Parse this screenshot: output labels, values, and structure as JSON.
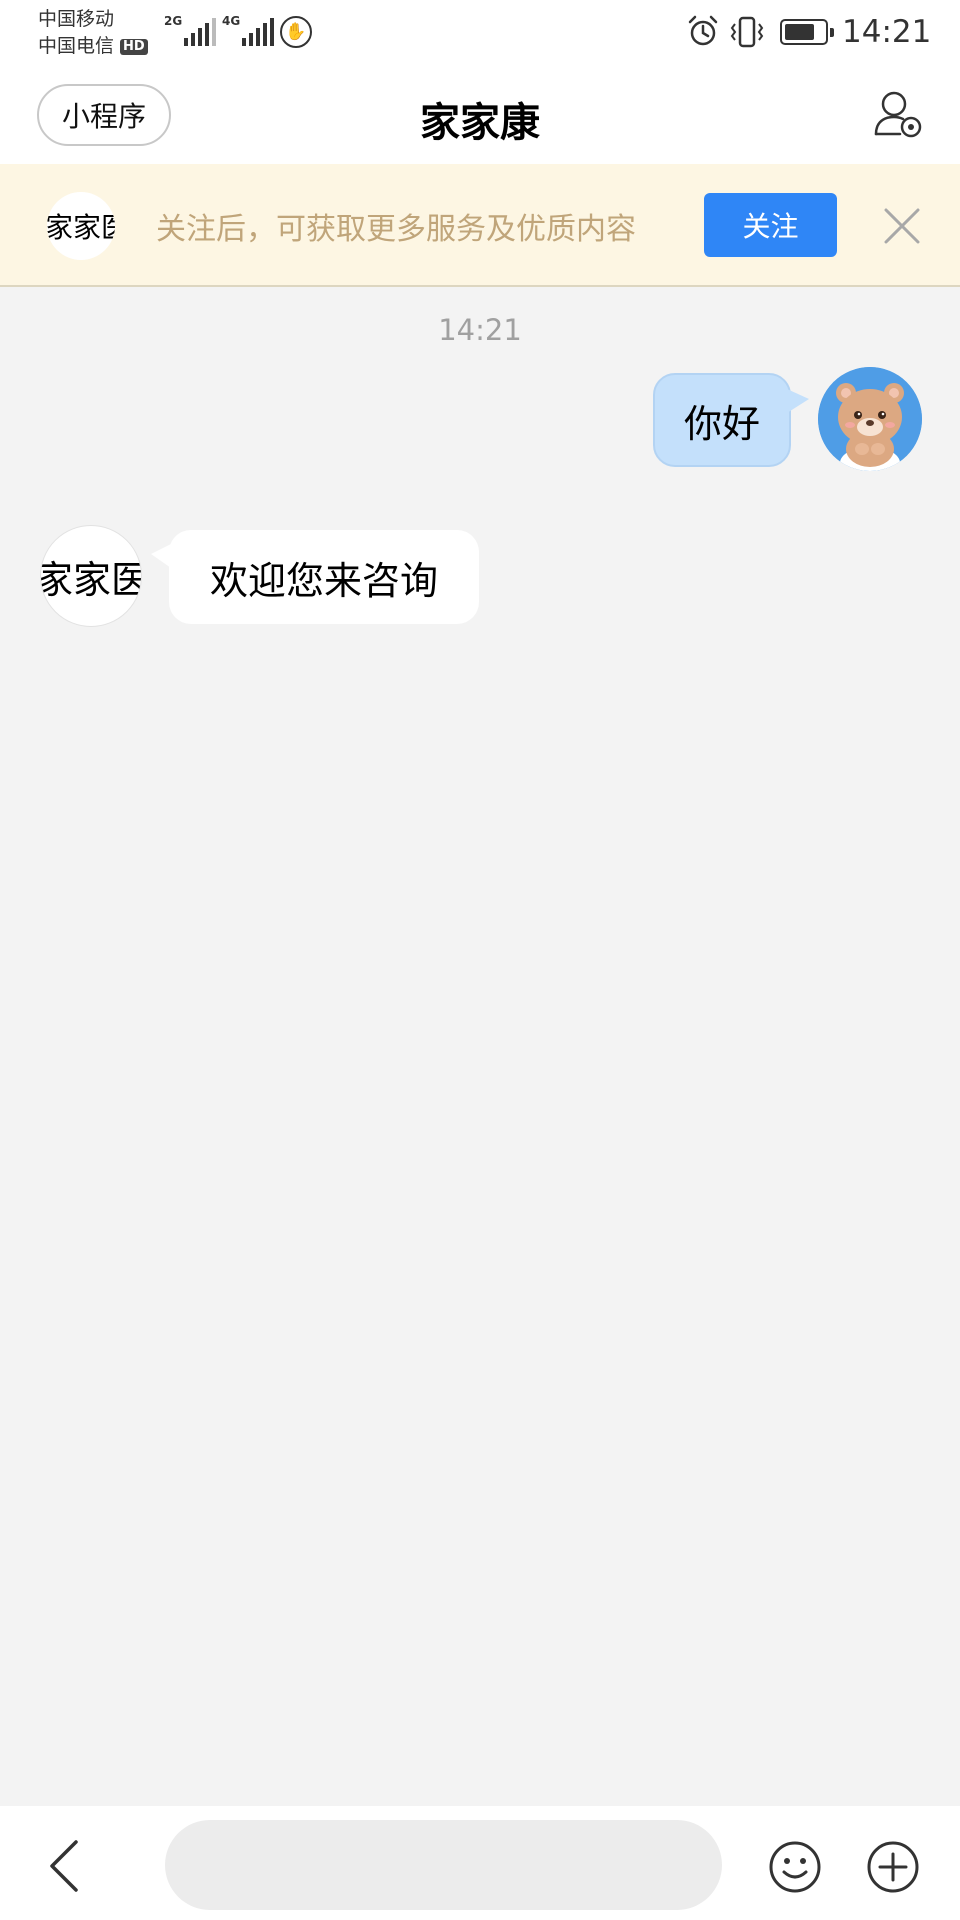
{
  "status_bar": {
    "carriers": [
      "中国移动",
      "中国电信"
    ],
    "hd_badge": "HD",
    "network_a": "2G",
    "network_b": "4G",
    "signal_a_level": 4,
    "signal_b_level": 5,
    "battery_level": 0.75,
    "time": "14:21",
    "icons": [
      "signal-icon",
      "hand-icon",
      "alarm-icon",
      "vibrate-icon",
      "battery-icon"
    ]
  },
  "header": {
    "mini_program_label": "小程序",
    "title": "家家康",
    "profile_icon": "profile-settings-icon"
  },
  "follow_banner": {
    "avatar_text": "家家医",
    "text": "关注后，可获取更多服务及优质内容",
    "follow_label": "关注",
    "close_icon": "close-icon",
    "background": "#fdf6e3",
    "text_color": "#c0a57a",
    "button_color": "#2f86f6"
  },
  "chat": {
    "timestamp": "14:21",
    "messages": [
      {
        "sender": "user",
        "text": "你好",
        "avatar": "bear-avatar"
      },
      {
        "sender": "bot",
        "text": "欢迎您来咨询",
        "avatar_text": "家家医"
      }
    ],
    "user_bubble_color": "#c4e0fb"
  },
  "input_bar": {
    "placeholder": "",
    "icons": [
      "back-arrow-icon",
      "emoji-icon",
      "plus-icon"
    ]
  }
}
